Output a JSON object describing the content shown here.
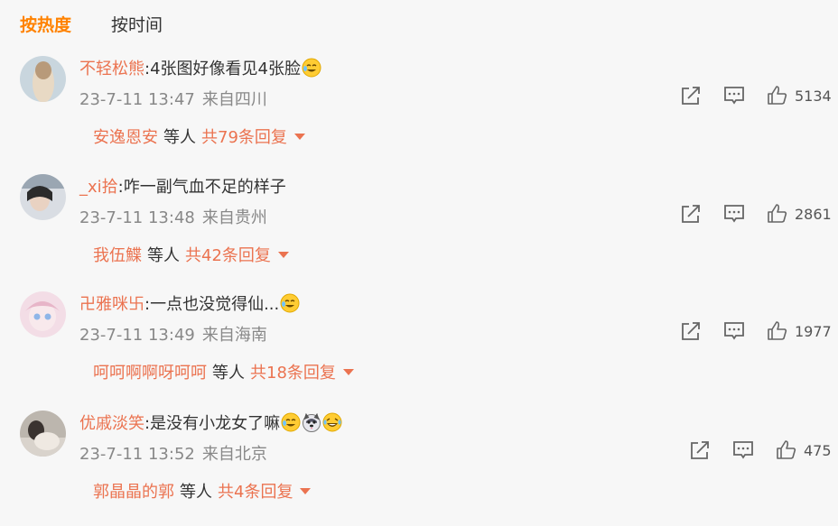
{
  "tabs": [
    {
      "label": "按热度",
      "active": true
    },
    {
      "label": "按时间",
      "active": false
    }
  ],
  "comments": [
    {
      "user": "不轻松熊",
      "text": "4张图好像看见4张脸",
      "emojis": [
        "cry-laugh-emoji"
      ],
      "time": "23-7-11 13:47",
      "location": "来自四川",
      "likes": "5134",
      "reply_names": "安逸恩安",
      "reply_mid": "等人",
      "reply_total": "共79条回复"
    },
    {
      "user": "_xi拾",
      "text": "咋一副气血不足的样子",
      "emojis": [],
      "time": "23-7-11 13:48",
      "location": "来自贵州",
      "likes": "2861",
      "reply_names": "我伍鰈",
      "reply_mid": "等人",
      "reply_total": "共42条回复"
    },
    {
      "user": "卍雅咪卐",
      "text": "一点也没觉得仙...",
      "emojis": [
        "cry-laugh-emoji"
      ],
      "time": "23-7-11 13:49",
      "location": "来自海南",
      "likes": "1977",
      "reply_names": "呵呵啊啊呀呵呵",
      "reply_mid": "等人",
      "reply_total": "共18条回复"
    },
    {
      "user": "优戚淡笑",
      "text": "是没有小龙女了嘛",
      "emojis": [
        "cry-laugh-emoji",
        "husky-emoji",
        "laugh-emoji"
      ],
      "time": "23-7-11 13:52",
      "location": "来自北京",
      "likes": "475",
      "reply_names": "郭晶晶的郭",
      "reply_mid": "等人",
      "reply_total": "共4条回复"
    }
  ],
  "colors": {
    "accent": "#ff8200",
    "username": "#eb7350",
    "meta": "#888888",
    "background": "#f7f7f7"
  },
  "icons": [
    "share-icon",
    "comment-icon",
    "like-icon",
    "caret-down-icon"
  ]
}
